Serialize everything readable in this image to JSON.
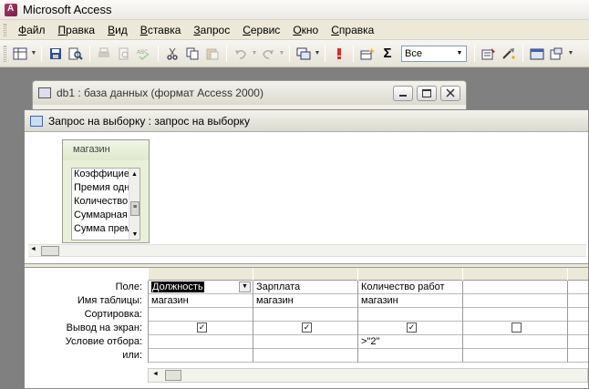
{
  "app": {
    "title": "Microsoft Access"
  },
  "menu": [
    "Файл",
    "Правка",
    "Вид",
    "Вставка",
    "Запрос",
    "Сервис",
    "Окно",
    "Справка"
  ],
  "toolbar": {
    "combo_value": "Все"
  },
  "db_window": {
    "title": "db1 : база данных (формат Access 2000)"
  },
  "query_window": {
    "title": "Запрос на выборку : запрос на выборку"
  },
  "table_box": {
    "title": "магазин",
    "fields": [
      "Коэффицие",
      "Премия одн",
      "Количество",
      "Суммарная",
      "Сумма прем"
    ]
  },
  "grid": {
    "row_labels": [
      "Поле:",
      "Имя таблицы:",
      "Сортировка:",
      "Вывод на экран:",
      "Условие отбора:",
      "или:"
    ],
    "columns": [
      {
        "field": "Должность",
        "table": "магазин",
        "sort": "",
        "show": true,
        "criteria": "",
        "or": ""
      },
      {
        "field": "Зарплата",
        "table": "магазин",
        "sort": "",
        "show": true,
        "criteria": "",
        "or": ""
      },
      {
        "field": "Количество работ",
        "table": "магазин",
        "sort": "",
        "show": true,
        "criteria": ">\"2\"",
        "or": ""
      },
      {
        "field": "",
        "table": "",
        "sort": "",
        "show": false,
        "criteria": "",
        "or": ""
      }
    ]
  },
  "icons": {
    "check": "✓"
  }
}
